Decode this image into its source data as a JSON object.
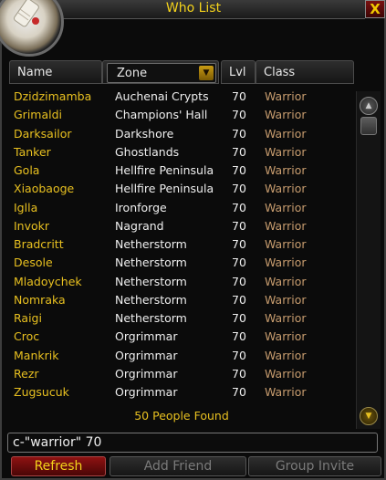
{
  "window": {
    "title": "Who List",
    "close_label": "X"
  },
  "header": {
    "name": "Name",
    "zone": "Zone",
    "zone_arrow": "▼",
    "level": "Lvl",
    "class": "Class"
  },
  "rows": [
    {
      "name": "Dzidzimamba",
      "zone": "Auchenai Crypts",
      "level": "70",
      "class": "Warrior"
    },
    {
      "name": "Grimaldi",
      "zone": "Champions' Hall",
      "level": "70",
      "class": "Warrior"
    },
    {
      "name": "Darksailor",
      "zone": "Darkshore",
      "level": "70",
      "class": "Warrior"
    },
    {
      "name": "Tanker",
      "zone": "Ghostlands",
      "level": "70",
      "class": "Warrior"
    },
    {
      "name": "Gola",
      "zone": "Hellfire Peninsula",
      "level": "70",
      "class": "Warrior"
    },
    {
      "name": "Xiaobaoge",
      "zone": "Hellfire Peninsula",
      "level": "70",
      "class": "Warrior"
    },
    {
      "name": "Iglla",
      "zone": "Ironforge",
      "level": "70",
      "class": "Warrior"
    },
    {
      "name": "Invokr",
      "zone": "Nagrand",
      "level": "70",
      "class": "Warrior"
    },
    {
      "name": "Bradcritt",
      "zone": "Netherstorm",
      "level": "70",
      "class": "Warrior"
    },
    {
      "name": "Desole",
      "zone": "Netherstorm",
      "level": "70",
      "class": "Warrior"
    },
    {
      "name": "Mladoychek",
      "zone": "Netherstorm",
      "level": "70",
      "class": "Warrior"
    },
    {
      "name": "Nomraka",
      "zone": "Netherstorm",
      "level": "70",
      "class": "Warrior"
    },
    {
      "name": "Raigi",
      "zone": "Netherstorm",
      "level": "70",
      "class": "Warrior"
    },
    {
      "name": "Croc",
      "zone": "Orgrimmar",
      "level": "70",
      "class": "Warrior"
    },
    {
      "name": "Mankrik",
      "zone": "Orgrimmar",
      "level": "70",
      "class": "Warrior"
    },
    {
      "name": "Rezr",
      "zone": "Orgrimmar",
      "level": "70",
      "class": "Warrior"
    },
    {
      "name": "Zugsucuk",
      "zone": "Orgrimmar",
      "level": "70",
      "class": "Warrior"
    }
  ],
  "found_text": "50 People Found",
  "search": {
    "value": "c-\"warrior\" 70"
  },
  "buttons": {
    "refresh": "Refresh",
    "add_friend": "Add Friend",
    "group_invite": "Group Invite"
  },
  "scrollbar": {
    "up": "▲",
    "down": "▼"
  },
  "colors": {
    "title": "#f3d21b",
    "player_name": "#e8c020",
    "class_warrior": "#c79c6e"
  }
}
